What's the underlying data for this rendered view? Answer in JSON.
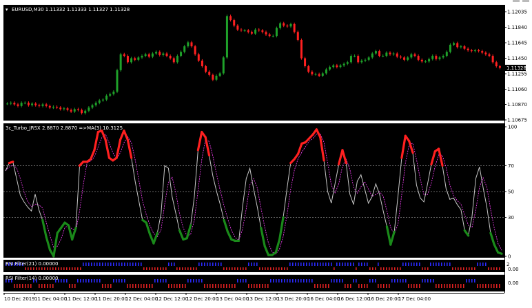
{
  "main_panel": {
    "title": "EURUSD,M30  1.11332 1.11333 1.11327 1.11328",
    "price_labels": [
      "1.12035",
      "1.11840",
      "1.11645",
      "1.11450",
      "1.11255",
      "1.11060",
      "1.10870",
      "1.10675"
    ],
    "current_price": "1.11328",
    "colors": {
      "up": "#1fa12a",
      "down": "#ff2020",
      "background": "#000000"
    }
  },
  "indicator_panel": {
    "title": "3c_Turbo_JRSX 2.8870 2.8870  =>MA(3) 10.3125",
    "levels": [
      "100",
      "70",
      "50",
      "30",
      "0"
    ],
    "colors": {
      "line": "#c8c8c8",
      "overbought": "#ff2020",
      "oversold": "#1a8a1a",
      "signal": "#ff40ff"
    }
  },
  "rsi_filter_21": {
    "title": "RSI Filter(21) 0.00000",
    "labels": [
      "2",
      "0.00"
    ]
  },
  "rsi_filter_14": {
    "title": "RSI Filter(14) 0.00000",
    "labels": [
      "0.00"
    ]
  },
  "time_axis": {
    "labels": [
      "10 Dec 2019",
      "11 Dec 04:00",
      "11 Dec 12:00",
      "11 Dec 20:00",
      "12 Dec 04:00",
      "12 Dec 12:00",
      "12 Dec 20:00",
      "13 Dec 04:00",
      "13 Dec 12:00",
      "13 Dec 20:00",
      "16 Dec 04:00",
      "16 Dec 12:00",
      "16 Dec 20:00",
      "17 Dec 04:00"
    ]
  },
  "chart_data": {
    "type": "line",
    "price_close": [
      1.1088,
      1.1089,
      1.1087,
      1.1085,
      1.1089,
      1.1089,
      1.1086,
      1.1088,
      1.1086,
      1.1085,
      1.1087,
      1.1085,
      1.1083,
      1.1084,
      1.1083,
      1.1081,
      1.1082,
      1.108,
      1.1078,
      1.1081,
      1.108,
      1.1076,
      1.1079,
      1.1083,
      1.1086,
      1.1089,
      1.1092,
      1.1093,
      1.1098,
      1.11,
      1.1103,
      1.113,
      1.115,
      1.1148,
      1.114,
      1.1145,
      1.1143,
      1.1146,
      1.1148,
      1.115,
      1.1147,
      1.1151,
      1.1153,
      1.1149,
      1.1151,
      1.1148,
      1.1145,
      1.114,
      1.1148,
      1.1153,
      1.116,
      1.1165,
      1.116,
      1.115,
      1.1142,
      1.1135,
      1.1128,
      1.1124,
      1.1118,
      1.1123,
      1.1126,
      1.1146,
      1.1198,
      1.1193,
      1.1186,
      1.1181,
      1.118,
      1.118,
      1.1178,
      1.1176,
      1.1181,
      1.118,
      1.1178,
      1.1175,
      1.1173,
      1.1173,
      1.1183,
      1.1189,
      1.1186,
      1.1185,
      1.1188,
      1.1178,
      1.1168,
      1.1145,
      1.1135,
      1.1128,
      1.1125,
      1.1125,
      1.1123,
      1.1126,
      1.1131,
      1.1134,
      1.1136,
      1.1134,
      1.1136,
      1.1138,
      1.114,
      1.1148,
      1.1148,
      1.114,
      1.1142,
      1.1143,
      1.1146,
      1.1151,
      1.1154,
      1.1148,
      1.1148,
      1.1152,
      1.115,
      1.1151,
      1.1147,
      1.1146,
      1.1143,
      1.1146,
      1.115,
      1.1148,
      1.1143,
      1.1141,
      1.1141,
      1.1144,
      1.1148,
      1.1144,
      1.1146,
      1.1148,
      1.1153,
      1.1162,
      1.1164,
      1.1159,
      1.116,
      1.1157,
      1.1155,
      1.1154,
      1.1155,
      1.1154,
      1.1152,
      1.115,
      1.1148,
      1.114,
      1.1135,
      1.1133
    ],
    "jrsx": [
      66,
      72,
      73,
      60,
      47,
      42,
      38,
      35,
      48,
      36,
      28,
      15,
      5,
      0,
      18,
      22,
      26,
      24,
      13,
      22,
      70,
      73,
      73,
      75,
      82,
      96,
      97,
      90,
      76,
      74,
      76,
      90,
      97,
      90,
      76,
      58,
      43,
      28,
      26,
      17,
      10,
      18,
      33,
      70,
      68,
      46,
      33,
      20,
      13,
      14,
      24,
      46,
      82,
      96,
      92,
      78,
      62,
      50,
      40,
      28,
      19,
      13,
      12,
      12,
      38,
      60,
      68,
      52,
      38,
      22,
      8,
      1,
      1,
      3,
      13,
      30,
      52,
      72,
      75,
      79,
      87,
      88,
      91,
      94,
      98,
      92,
      74,
      50,
      41,
      56,
      71,
      82,
      72,
      48,
      40,
      58,
      63,
      52,
      41,
      46,
      56,
      48,
      35,
      23,
      9,
      19,
      47,
      76,
      93,
      89,
      80,
      55,
      45,
      42,
      56,
      71,
      81,
      83,
      70,
      52,
      44,
      45,
      40,
      36,
      20,
      16,
      31,
      60,
      69,
      53,
      38,
      18,
      9,
      3,
      2
    ],
    "jrsx_ylim": [
      0,
      100
    ],
    "levels": [
      30,
      50,
      70
    ],
    "price_ylim": [
      1.10675,
      1.12035
    ]
  }
}
